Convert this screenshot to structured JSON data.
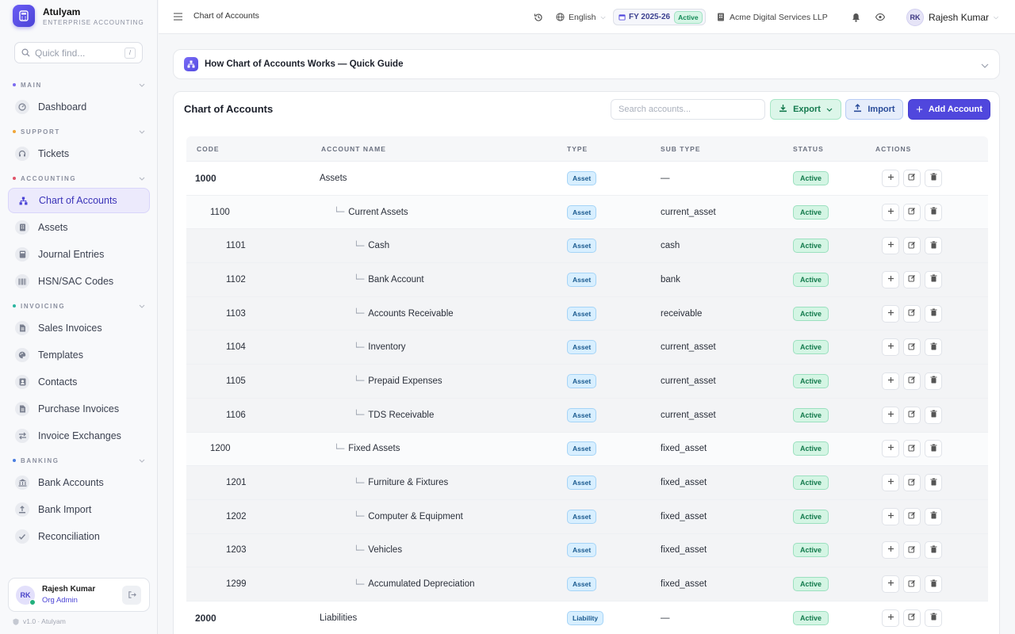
{
  "brand": {
    "name": "Atulyam",
    "subtitle": "ENTERPRISE ACCOUNTING"
  },
  "quickfind": {
    "placeholder": "Quick find...",
    "shortcut": "/"
  },
  "sidebar": {
    "sections": [
      {
        "label": "MAIN",
        "dot_color": "#7c6cf0",
        "items": [
          {
            "label": "Dashboard",
            "icon": "dashboard-icon"
          }
        ]
      },
      {
        "label": "SUPPORT",
        "dot_color": "#f0a63a",
        "items": [
          {
            "label": "Tickets",
            "icon": "headset-icon"
          }
        ]
      },
      {
        "label": "ACCOUNTING",
        "dot_color": "#e0546a",
        "items": [
          {
            "label": "Chart of Accounts",
            "icon": "hierarchy-icon",
            "active": true
          },
          {
            "label": "Assets",
            "icon": "building-icon"
          },
          {
            "label": "Journal Entries",
            "icon": "book-icon"
          },
          {
            "label": "HSN/SAC Codes",
            "icon": "barcode-icon"
          }
        ]
      },
      {
        "label": "INVOICING",
        "dot_color": "#2bb5a0",
        "items": [
          {
            "label": "Sales Invoices",
            "icon": "document-icon"
          },
          {
            "label": "Templates",
            "icon": "palette-icon"
          },
          {
            "label": "Contacts",
            "icon": "contact-icon"
          },
          {
            "label": "Purchase Invoices",
            "icon": "document-icon"
          },
          {
            "label": "Invoice Exchanges",
            "icon": "exchange-icon"
          }
        ]
      },
      {
        "label": "BANKING",
        "dot_color": "#4a7ee0",
        "items": [
          {
            "label": "Bank Accounts",
            "icon": "bank-icon"
          },
          {
            "label": "Bank Import",
            "icon": "upload-icon"
          },
          {
            "label": "Reconciliation",
            "icon": "check-icon"
          }
        ]
      }
    ]
  },
  "user": {
    "initials": "RK",
    "name": "Rajesh Kumar",
    "role": "Org Admin"
  },
  "version": "v1.0 · Atulyam",
  "topbar": {
    "breadcrumb": "Chart of Accounts",
    "language": "English",
    "fy": "FY 2025-26",
    "fy_status": "Active",
    "company": "Acme Digital Services LLP",
    "user_initials": "RK",
    "user_name": "Rajesh Kumar"
  },
  "guide": {
    "title": "How Chart of Accounts Works — Quick Guide"
  },
  "card": {
    "title": "Chart of Accounts",
    "search_placeholder": "Search accounts...",
    "export_label": "Export",
    "import_label": "Import",
    "add_label": "Add Account"
  },
  "table": {
    "headers": [
      "CODE",
      "ACCOUNT NAME",
      "TYPE",
      "SUB TYPE",
      "STATUS",
      "ACTIONS"
    ],
    "rows": [
      {
        "code": "1000",
        "name": "Assets",
        "type": "Asset",
        "subtype": "—",
        "status": "Active",
        "level": 0
      },
      {
        "code": "1100",
        "name": "Current Assets",
        "type": "Asset",
        "subtype": "current_asset",
        "status": "Active",
        "level": 1
      },
      {
        "code": "1101",
        "name": "Cash",
        "type": "Asset",
        "subtype": "cash",
        "status": "Active",
        "level": 2
      },
      {
        "code": "1102",
        "name": "Bank Account",
        "type": "Asset",
        "subtype": "bank",
        "status": "Active",
        "level": 2
      },
      {
        "code": "1103",
        "name": "Accounts Receivable",
        "type": "Asset",
        "subtype": "receivable",
        "status": "Active",
        "level": 2
      },
      {
        "code": "1104",
        "name": "Inventory",
        "type": "Asset",
        "subtype": "current_asset",
        "status": "Active",
        "level": 2
      },
      {
        "code": "1105",
        "name": "Prepaid Expenses",
        "type": "Asset",
        "subtype": "current_asset",
        "status": "Active",
        "level": 2
      },
      {
        "code": "1106",
        "name": "TDS Receivable",
        "type": "Asset",
        "subtype": "current_asset",
        "status": "Active",
        "level": 2
      },
      {
        "code": "1200",
        "name": "Fixed Assets",
        "type": "Asset",
        "subtype": "fixed_asset",
        "status": "Active",
        "level": 1
      },
      {
        "code": "1201",
        "name": "Furniture & Fixtures",
        "type": "Asset",
        "subtype": "fixed_asset",
        "status": "Active",
        "level": 2
      },
      {
        "code": "1202",
        "name": "Computer & Equipment",
        "type": "Asset",
        "subtype": "fixed_asset",
        "status": "Active",
        "level": 2
      },
      {
        "code": "1203",
        "name": "Vehicles",
        "type": "Asset",
        "subtype": "fixed_asset",
        "status": "Active",
        "level": 2
      },
      {
        "code": "1299",
        "name": "Accumulated Depreciation",
        "type": "Asset",
        "subtype": "fixed_asset",
        "status": "Active",
        "level": 2
      },
      {
        "code": "2000",
        "name": "Liabilities",
        "type": "Liability",
        "subtype": "—",
        "status": "Active",
        "level": 0
      }
    ]
  },
  "colors": {
    "accent": "#5047dd",
    "active_green": "#137a4c",
    "type_blue": "#1a5a8f"
  }
}
